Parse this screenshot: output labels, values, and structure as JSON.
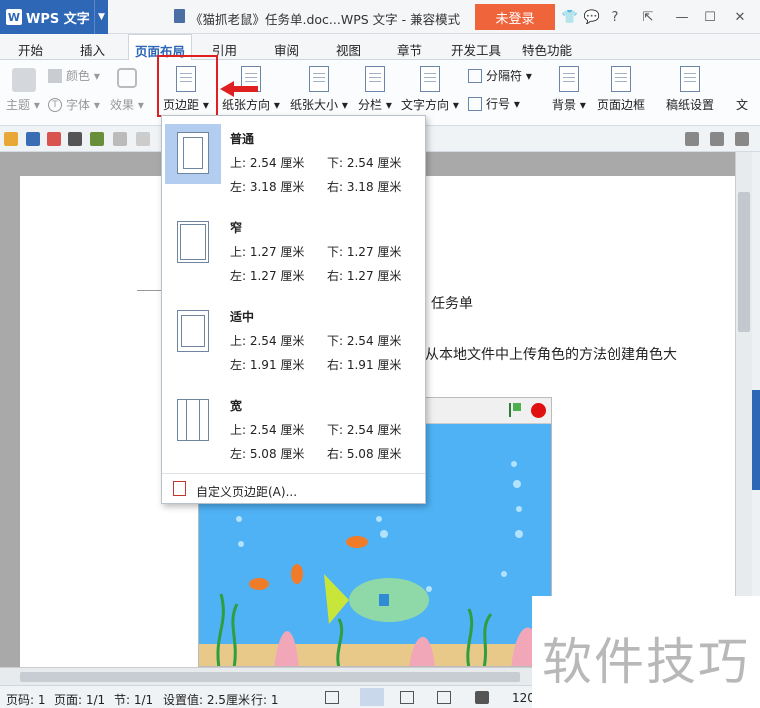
{
  "titlebar": {
    "app_name": "WPS 文字",
    "doc_title": "《猫抓老鼠》任务单.doc...WPS 文字 - 兼容模式",
    "login_label": "未登录"
  },
  "menu": {
    "tabs": [
      {
        "label": "开始"
      },
      {
        "label": "插入"
      },
      {
        "label": "页面布局"
      },
      {
        "label": "引用"
      },
      {
        "label": "审阅"
      },
      {
        "label": "视图"
      },
      {
        "label": "章节"
      },
      {
        "label": "开发工具"
      },
      {
        "label": "特色功能"
      }
    ]
  },
  "ribbon": {
    "theme": "主题",
    "colors": "颜色",
    "font": "字体",
    "effects": "效果",
    "margins": "页边距",
    "orientation": "纸张方向",
    "size": "纸张大小",
    "columns": "分栏",
    "text_direction": "文字方向",
    "breaks": "分隔符",
    "line_numbers": "行号",
    "background": "背景",
    "page_borders": "页面边框",
    "manuscript": "稿纸设置",
    "more": "文"
  },
  "margins_menu": {
    "options": [
      {
        "name": "普通",
        "top": "上: 2.54 厘米",
        "bottom": "下: 2.54 厘米",
        "left": "左: 3.18 厘米",
        "right": "右: 3.18 厘米"
      },
      {
        "name": "窄",
        "top": "上: 1.27 厘米",
        "bottom": "下: 1.27 厘米",
        "left": "左: 1.27 厘米",
        "right": "右: 1.27 厘米"
      },
      {
        "name": "适中",
        "top": "上: 2.54 厘米",
        "bottom": "下: 2.54 厘米",
        "left": "左: 1.91 厘米",
        "right": "右: 1.91 厘米"
      },
      {
        "name": "宽",
        "top": "上: 2.54 厘米",
        "bottom": "下: 2.54 厘米",
        "left": "左: 5.08 厘米",
        "right": "右: 5.08 厘米"
      }
    ],
    "custom": "自定义页边距(A)..."
  },
  "document": {
    "line1": "任务单",
    "line2": "从本地文件中上传角色的方法创建角色大"
  },
  "status": {
    "page_code": "页码: 1",
    "page": "页面: 1/1",
    "section": "节: 1/1",
    "setting": "设置值: 2.5厘米",
    "row": "行: 1",
    "zoom": "120"
  },
  "watermark": "软件技巧",
  "colors": {
    "accent": "#2d67b6",
    "login": "#f0643c",
    "highlight": "#e02020"
  }
}
